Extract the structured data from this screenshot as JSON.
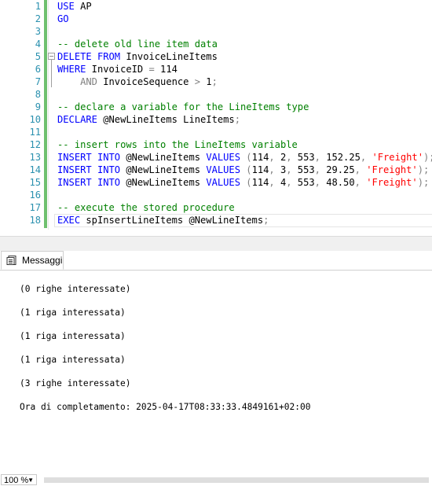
{
  "editor": {
    "lines": [
      {
        "n": "1",
        "tokens": [
          {
            "t": "USE",
            "c": "kw"
          },
          {
            "t": " AP",
            "c": "tx"
          }
        ]
      },
      {
        "n": "2",
        "tokens": [
          {
            "t": "GO",
            "c": "kw"
          }
        ]
      },
      {
        "n": "3",
        "tokens": []
      },
      {
        "n": "4",
        "tokens": [
          {
            "t": "-- delete old line item data",
            "c": "cm"
          }
        ]
      },
      {
        "n": "5",
        "fold": true,
        "tokens": [
          {
            "t": "DELETE",
            "c": "kw"
          },
          {
            "t": " ",
            "c": "tx"
          },
          {
            "t": "FROM",
            "c": "kw"
          },
          {
            "t": " InvoiceLineItems",
            "c": "tx"
          }
        ]
      },
      {
        "n": "6",
        "tokens": [
          {
            "t": "WHERE",
            "c": "kw"
          },
          {
            "t": " InvoiceID ",
            "c": "tx"
          },
          {
            "t": "=",
            "c": "gr"
          },
          {
            "t": " 114",
            "c": "tx"
          }
        ]
      },
      {
        "n": "7",
        "tokens": [
          {
            "t": "    ",
            "c": "tx"
          },
          {
            "t": "AND",
            "c": "gr"
          },
          {
            "t": " InvoiceSequence ",
            "c": "tx"
          },
          {
            "t": ">",
            "c": "gr"
          },
          {
            "t": " 1",
            "c": "tx"
          },
          {
            "t": ";",
            "c": "gr"
          }
        ]
      },
      {
        "n": "8",
        "tokens": []
      },
      {
        "n": "9",
        "tokens": [
          {
            "t": "-- declare a variable for the LineItems type",
            "c": "cm"
          }
        ]
      },
      {
        "n": "10",
        "tokens": [
          {
            "t": "DECLARE",
            "c": "kw"
          },
          {
            "t": " @NewLineItems LineItems",
            "c": "tx"
          },
          {
            "t": ";",
            "c": "gr"
          }
        ]
      },
      {
        "n": "11",
        "tokens": []
      },
      {
        "n": "12",
        "tokens": [
          {
            "t": "-- insert rows into the LineItems variable",
            "c": "cm"
          }
        ]
      },
      {
        "n": "13",
        "tokens": [
          {
            "t": "INSERT",
            "c": "kw"
          },
          {
            "t": " ",
            "c": "tx"
          },
          {
            "t": "INTO",
            "c": "kw"
          },
          {
            "t": " @NewLineItems ",
            "c": "tx"
          },
          {
            "t": "VALUES",
            "c": "kw"
          },
          {
            "t": " ",
            "c": "tx"
          },
          {
            "t": "(",
            "c": "gr"
          },
          {
            "t": "114",
            "c": "tx"
          },
          {
            "t": ",",
            "c": "gr"
          },
          {
            "t": " 2",
            "c": "tx"
          },
          {
            "t": ",",
            "c": "gr"
          },
          {
            "t": " 553",
            "c": "tx"
          },
          {
            "t": ",",
            "c": "gr"
          },
          {
            "t": " 152.25",
            "c": "tx"
          },
          {
            "t": ",",
            "c": "gr"
          },
          {
            "t": " ",
            "c": "tx"
          },
          {
            "t": "'Freight'",
            "c": "st"
          },
          {
            "t": ");",
            "c": "gr"
          }
        ]
      },
      {
        "n": "14",
        "tokens": [
          {
            "t": "INSERT",
            "c": "kw"
          },
          {
            "t": " ",
            "c": "tx"
          },
          {
            "t": "INTO",
            "c": "kw"
          },
          {
            "t": " @NewLineItems ",
            "c": "tx"
          },
          {
            "t": "VALUES",
            "c": "kw"
          },
          {
            "t": " ",
            "c": "tx"
          },
          {
            "t": "(",
            "c": "gr"
          },
          {
            "t": "114",
            "c": "tx"
          },
          {
            "t": ",",
            "c": "gr"
          },
          {
            "t": " 3",
            "c": "tx"
          },
          {
            "t": ",",
            "c": "gr"
          },
          {
            "t": " 553",
            "c": "tx"
          },
          {
            "t": ",",
            "c": "gr"
          },
          {
            "t": " 29.25",
            "c": "tx"
          },
          {
            "t": ",",
            "c": "gr"
          },
          {
            "t": " ",
            "c": "tx"
          },
          {
            "t": "'Freight'",
            "c": "st"
          },
          {
            "t": ");",
            "c": "gr"
          }
        ]
      },
      {
        "n": "15",
        "tokens": [
          {
            "t": "INSERT",
            "c": "kw"
          },
          {
            "t": " ",
            "c": "tx"
          },
          {
            "t": "INTO",
            "c": "kw"
          },
          {
            "t": " @NewLineItems ",
            "c": "tx"
          },
          {
            "t": "VALUES",
            "c": "kw"
          },
          {
            "t": " ",
            "c": "tx"
          },
          {
            "t": "(",
            "c": "gr"
          },
          {
            "t": "114",
            "c": "tx"
          },
          {
            "t": ",",
            "c": "gr"
          },
          {
            "t": " 4",
            "c": "tx"
          },
          {
            "t": ",",
            "c": "gr"
          },
          {
            "t": " 553",
            "c": "tx"
          },
          {
            "t": ",",
            "c": "gr"
          },
          {
            "t": " 48.50",
            "c": "tx"
          },
          {
            "t": ",",
            "c": "gr"
          },
          {
            "t": " ",
            "c": "tx"
          },
          {
            "t": "'Freight'",
            "c": "st"
          },
          {
            "t": ");",
            "c": "gr"
          }
        ]
      },
      {
        "n": "16",
        "tokens": []
      },
      {
        "n": "17",
        "tokens": [
          {
            "t": "-- execute the stored procedure",
            "c": "cm"
          }
        ]
      },
      {
        "n": "18",
        "tokens": [
          {
            "t": "EXEC",
            "c": "kw"
          },
          {
            "t": " spInsertLineItems @NewLineItems",
            "c": "tx"
          },
          {
            "t": ";",
            "c": "gr"
          }
        ]
      }
    ]
  },
  "status": {
    "zoom": "100 %"
  },
  "results": {
    "tab_label": "Messaggi",
    "messages": [
      "(0 righe interessate)",
      "(1 riga interessata)",
      "(1 riga interessata)",
      "(1 riga interessata)",
      "(3 righe interessate)",
      "Ora di completamento: 2025-04-17T08:33:33.4849161+02:00"
    ]
  },
  "colors": {
    "keyword": "#0000ff",
    "comment": "#008000",
    "string": "#ff0000",
    "operator": "#808080",
    "line_number": "#2b91af",
    "change_bar": "#6fc06f"
  },
  "icons": {
    "messages_tab": "messages-icon",
    "fold": "collapse-toggle-icon"
  }
}
